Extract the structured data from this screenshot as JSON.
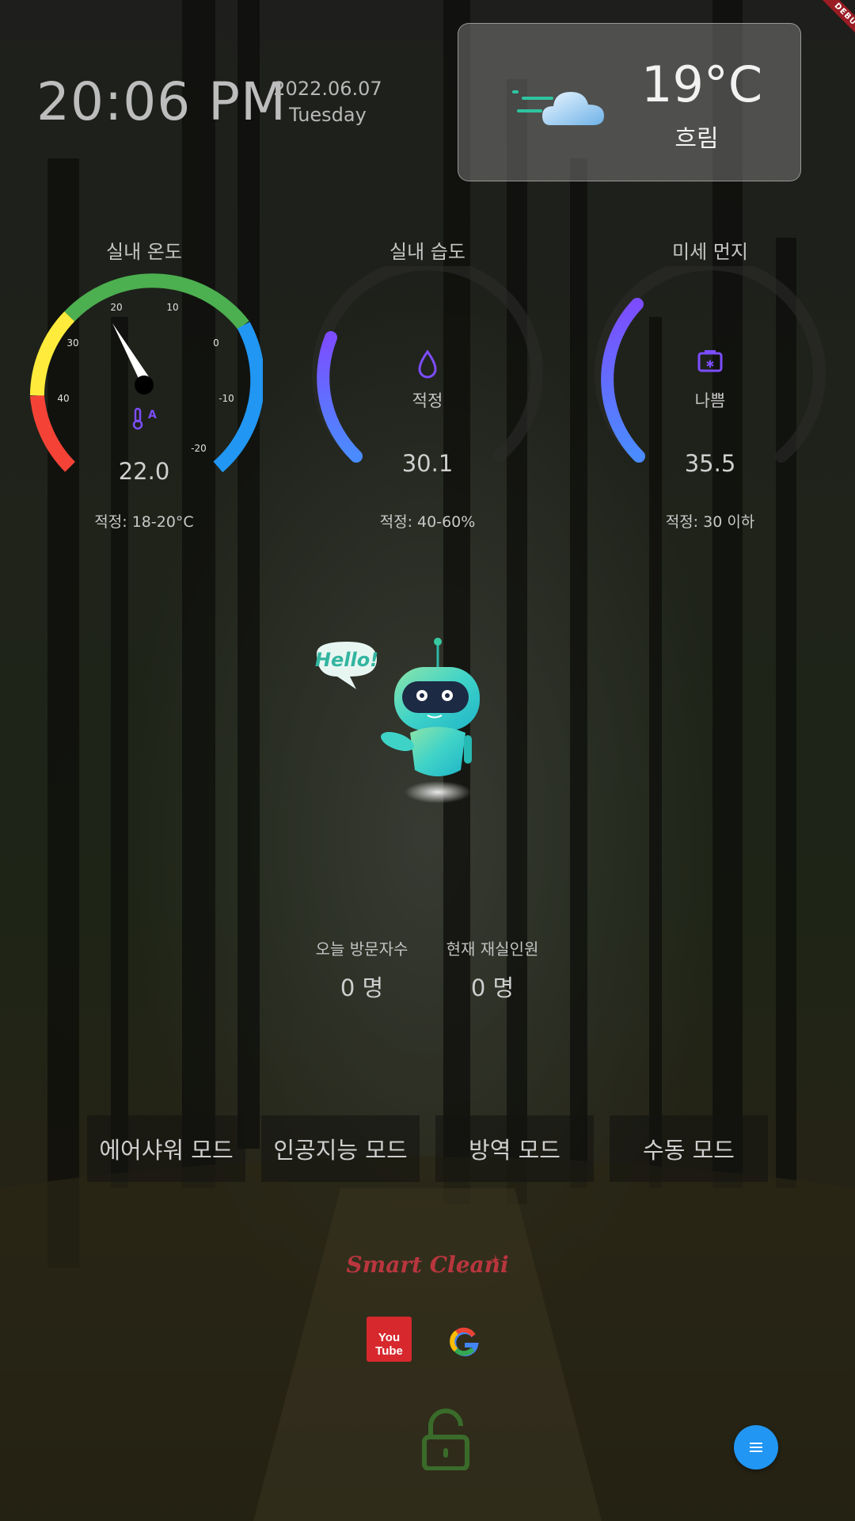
{
  "header": {
    "time": "20:06 PM",
    "date": "2022.06.07",
    "weekday": "Tuesday",
    "debug_label": "DEBUG"
  },
  "weather": {
    "temperature": "19°C",
    "condition": "흐림",
    "icon": "cloud-wind-icon"
  },
  "gauges": {
    "temperature": {
      "title": "실내 온도",
      "value": "22.0",
      "range_text": "적정: 18-20°C",
      "ticks": [
        "40",
        "30",
        "20",
        "10",
        "0",
        "-10",
        "-20"
      ],
      "icon": "thermometer-icon"
    },
    "humidity": {
      "title": "실내 습도",
      "value": "30.1",
      "state": "적정",
      "range_text": "적정: 40-60%",
      "fill": 0.33,
      "icon": "water-drop-icon"
    },
    "dust": {
      "title": "미세 먼지",
      "value": "35.5",
      "state": "나쁨",
      "range_text": "적정: 30 이하",
      "fill": 0.33,
      "icon": "dust-camera-icon"
    }
  },
  "robot": {
    "speech": "Hello!"
  },
  "stats": {
    "visitors_label": "오늘 방문자수",
    "visitors_value": "0 명",
    "occupancy_label": "현재 재실인원",
    "occupancy_value": "0 명"
  },
  "modes": [
    "에어샤워 모드",
    "인공지능 모드",
    "방역 모드",
    "수동 모드"
  ],
  "brand": "Smart Cleani",
  "links": {
    "youtube_label": "You Tube",
    "google_label": "G"
  },
  "colors": {
    "fab": "#2196f3",
    "lock": "#3a6b2a",
    "gauge_gradient": [
      "#7c4dff",
      "#4a8cff"
    ],
    "brand": "#b9363e"
  }
}
